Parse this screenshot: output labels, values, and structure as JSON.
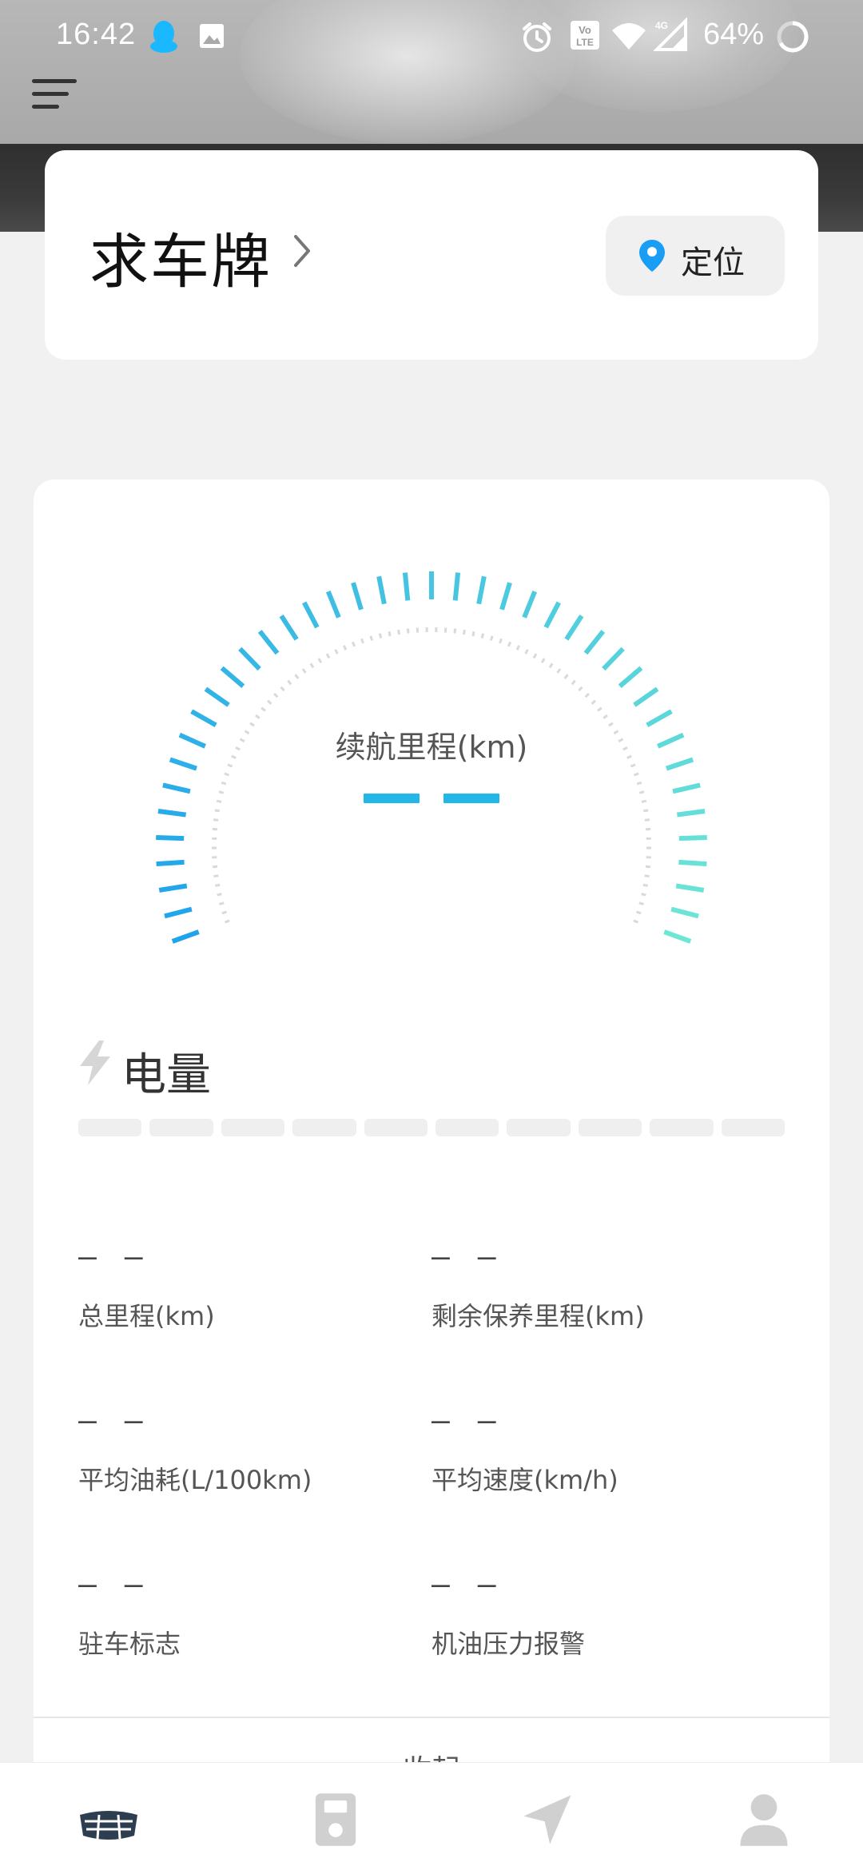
{
  "status_bar": {
    "time": "16:42",
    "battery": "64%",
    "icons": [
      "qq-icon",
      "image-icon",
      "alarm-icon",
      "volte-icon",
      "wifi-icon",
      "signal-4g-icon",
      "battery-ring-icon"
    ]
  },
  "header": {
    "menu_icon": "hamburger-menu-icon"
  },
  "vehicle_card": {
    "plate_title": "求车牌",
    "locate_label": "定位",
    "accent_color": "#1a9ef5"
  },
  "gauge": {
    "range_label": "续航里程(km)",
    "range_value": "--",
    "color_start": "#1fa3ec",
    "color_end": "#6ee6d6"
  },
  "battery_section": {
    "label": "电量",
    "segments": 10,
    "level": 0
  },
  "stats": [
    {
      "value": "— —",
      "label": "总里程(km)"
    },
    {
      "value": "— —",
      "label": "剩余保养里程(km)"
    },
    {
      "value": "— —",
      "label": "平均油耗(L/100km)"
    },
    {
      "value": "— —",
      "label": "平均速度(km/h)"
    },
    {
      "value": "— —",
      "label": "驻车标志"
    },
    {
      "value": "— —",
      "label": "机油压力报警"
    }
  ],
  "collapse_label": "收起",
  "bottom_nav": {
    "items": [
      {
        "name": "car-logo-icon"
      },
      {
        "name": "device-icon"
      },
      {
        "name": "navigation-arrow-icon"
      },
      {
        "name": "profile-icon"
      }
    ]
  }
}
